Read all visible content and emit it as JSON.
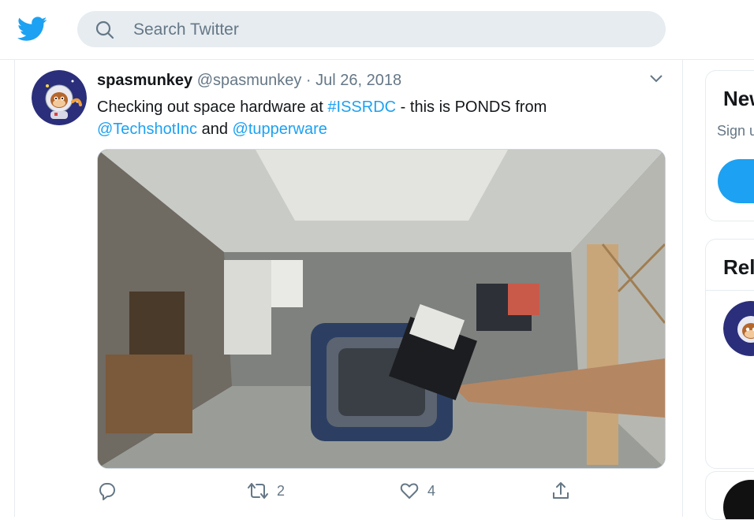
{
  "header": {
    "logo_icon": "twitter-bird-icon",
    "search_placeholder": "Search Twitter",
    "search_icon": "search-icon"
  },
  "tweet": {
    "display_name": "spasmunkey",
    "handle": "@spasmunkey",
    "separator": "·",
    "date": "Jul 26, 2018",
    "text": {
      "part1": "Checking out space hardware at ",
      "hashtag": "#ISSRDC",
      "part2": " - this is PONDS from",
      "mention1": "@TechshotInc",
      "part3": " and ",
      "mention2": "@tupperware"
    },
    "media_description_icon": "photo",
    "actions": {
      "reply_count": "",
      "retweet_count": "2",
      "like_count": "4"
    }
  },
  "sidebar": {
    "new_card_title": "New",
    "new_card_text": "Sign u",
    "related_title": "Rel"
  },
  "colors": {
    "accent": "#1da1f2",
    "muted": "#657786",
    "border": "#e6ecf0",
    "search_bg": "#e6ecf0"
  }
}
